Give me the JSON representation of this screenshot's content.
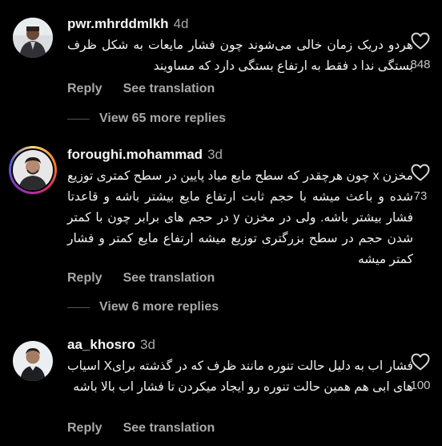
{
  "comments": [
    {
      "username": "pwr.mhrddmlkh",
      "age": "4d",
      "text": "هردو دریک زمان خالی می‌شوند چون فشار مایعات به شکل ظرف بستگی ندا د فقط به ارتفاع بستگی دارد که مساویند",
      "likes": "848",
      "reply_label": "Reply",
      "translate_label": "See translation",
      "view_more": "View 65 more replies"
    },
    {
      "username": "foroughi.mohammad",
      "age": "3d",
      "text": "مخزن x چون هرچقدر که سطح مایع میاد پایین در سطح کمتری توزیع شده و باعث میشه با حجم ثابت ارتفاع مایع بیشتر باشه و قاعدتا فشار بیشتر باشه. ولی در مخزن y در حجم های برابر چون با کمتر شدن حجم در سطح بزرگتری توزیع میشه ارتفاع مایع کمتر و فشار کمتر میشه",
      "likes": "73",
      "reply_label": "Reply",
      "translate_label": "See translation",
      "view_more": "View 6 more replies"
    },
    {
      "username": "aa_khosro",
      "age": "3d",
      "text": "فشار اب به دلیل حالت تنوره مانند ظرف که در گذشته برایX اسیاب های ابی هم همین حالت تنوره رو ایجاد میکردن تا فشار اب بالا باشه",
      "likes": "100",
      "reply_label": "Reply",
      "translate_label": "See translation"
    }
  ],
  "colors": {
    "background": "#000000",
    "text": "#f5f5f5",
    "secondary": "#a8a8a8"
  },
  "icons": {
    "like": "heart-outline-icon"
  }
}
